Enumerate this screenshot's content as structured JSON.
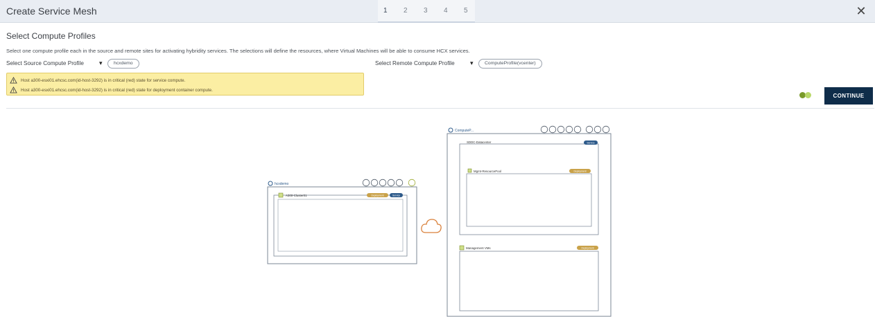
{
  "window": {
    "title": "Create Service Mesh",
    "steps": [
      "1",
      "2",
      "3",
      "4",
      "5"
    ],
    "active_step": "1",
    "close_icon": "close-icon"
  },
  "section": {
    "title": "Select Compute Profiles",
    "description": "Select one compute profile each in the source and remote sites for activating hybridity services. The selections will define the resources, where Virtual Machines will be able to consume HCX services."
  },
  "source": {
    "label": "Select Source Compute Profile",
    "value": "hcxdemo"
  },
  "remote": {
    "label": "Select Remote Compute Profile",
    "value": "ComputeProfile(vcenter)"
  },
  "warnings": [
    "Host a300-esxi01.ehcsc.com(id-host-3292) is in critical (red) state for service compute.",
    "Host a300-esxi01.ehcsc.com(id-host-3292) is in critical (red) state for deployment container compute."
  ],
  "actions": {
    "continue_label": "CONTINUE"
  },
  "colors": {
    "primary": "#0f2d4a",
    "warning_bg": "#fbeea3",
    "badge_gold": "#c9a24a",
    "badge_blue": "#2d5a8a",
    "cloud": "#d9803a",
    "dot_dark": "#7a9a2a",
    "dot_light": "#b9d86a"
  },
  "diagram": {
    "source_profile": {
      "name": "hcxdemo",
      "cluster": "A300-Cluster01",
      "badges": [
        "Deployment",
        "Service"
      ]
    },
    "remote_profile": {
      "name": "ComputeP...",
      "datacenter": "SDDC-Datacenter",
      "datacenter_badge": "Service",
      "resource_pool": "Mgmt-ResourcePool",
      "resource_pool_badge": "Deployment",
      "management": "Management VMs",
      "management_badge": "Deployment"
    }
  }
}
